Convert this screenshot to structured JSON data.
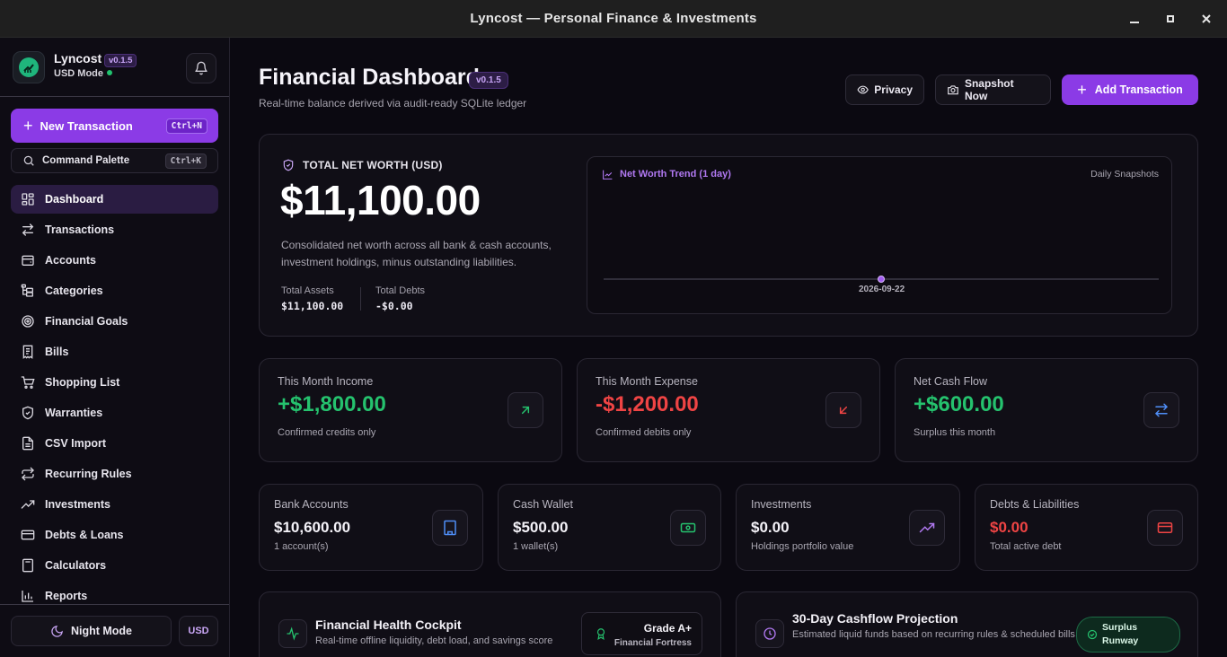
{
  "window": {
    "title": "Lyncost — Personal Finance & Investments",
    "min": "▁",
    "max": "▪",
    "close": "✕"
  },
  "brand": {
    "name": "Lyncost",
    "version": "v0.1.5",
    "mode": "USD Mode"
  },
  "sidebar": {
    "new_transaction": {
      "label": "New Transaction",
      "shortcut": "Ctrl+N"
    },
    "command_palette": {
      "label": "Command Palette",
      "shortcut": "Ctrl+K"
    },
    "items": [
      {
        "label": "Dashboard",
        "icon": "dashboard-icon",
        "active": true
      },
      {
        "label": "Transactions",
        "icon": "arrows-swap-icon"
      },
      {
        "label": "Accounts",
        "icon": "wallet-icon"
      },
      {
        "label": "Categories",
        "icon": "tree-icon"
      },
      {
        "label": "Financial Goals",
        "icon": "target-icon"
      },
      {
        "label": "Bills",
        "icon": "receipt-icon"
      },
      {
        "label": "Shopping List",
        "icon": "cart-icon"
      },
      {
        "label": "Warranties",
        "icon": "shield-check-icon"
      },
      {
        "label": "CSV Import",
        "icon": "file-icon"
      },
      {
        "label": "Recurring Rules",
        "icon": "repeat-icon"
      },
      {
        "label": "Investments",
        "icon": "trending-up-icon"
      },
      {
        "label": "Debts & Loans",
        "icon": "credit-card-icon"
      },
      {
        "label": "Calculators",
        "icon": "calculator-icon"
      },
      {
        "label": "Reports",
        "icon": "bar-chart-icon"
      }
    ],
    "night_mode": "Night Mode",
    "currency": "USD"
  },
  "header": {
    "title": "Financial Dashboard",
    "version": "v0.1.5",
    "subtitle": "Real-time balance derived via audit-ready SQLite ledger",
    "privacy": "Privacy",
    "snapshot": "Snapshot Now",
    "add_transaction": "Add Transaction"
  },
  "net_worth": {
    "label": "TOTAL NET WORTH (USD)",
    "value": "$11,100.00",
    "description": "Consolidated net worth across all bank & cash accounts, investment holdings, minus outstanding liabilities.",
    "assets_label": "Total Assets",
    "assets_value": "$11,100.00",
    "debts_label": "Total Debts",
    "debts_value": "-$0.00",
    "trend_title": "Net Worth Trend (1 day)",
    "trend_right": "Daily Snapshots"
  },
  "chart_data": {
    "type": "line",
    "title": "Net Worth Trend (1 day)",
    "x": [
      "2026-09-22"
    ],
    "series": [
      {
        "values": [
          11100
        ]
      }
    ]
  },
  "stats": [
    {
      "label": "This Month Income",
      "value": "+$1,800.00",
      "sub": "Confirmed credits only",
      "color": "#25c26e"
    },
    {
      "label": "This Month Expense",
      "value": "-$1,200.00",
      "sub": "Confirmed debits only",
      "color": "#ef4444"
    },
    {
      "label": "Net Cash Flow",
      "value": "+$600.00",
      "sub": "Surplus this month",
      "color": "#25c26e"
    }
  ],
  "accounts": [
    {
      "label": "Bank Accounts",
      "value": "$10,600.00",
      "sub": "1 account(s)"
    },
    {
      "label": "Cash Wallet",
      "value": "$500.00",
      "sub": "1 wallet(s)"
    },
    {
      "label": "Investments",
      "value": "$0.00",
      "sub": "Holdings portfolio value"
    },
    {
      "label": "Debts & Liabilities",
      "value": "$0.00",
      "sub": "Total active debt"
    }
  ],
  "health": {
    "title": "Financial Health Cockpit",
    "subtitle": "Real-time offline liquidity, debt load, and savings score",
    "grade": "Grade A+",
    "grade_sub": "Financial Fortress"
  },
  "projection": {
    "title": "30-Day Cashflow Projection",
    "subtitle": "Estimated liquid funds based on recurring rules & scheduled bills",
    "badge_line1": "Surplus",
    "badge_line2": "Runway"
  },
  "colors": {
    "accent": "#8b3be6",
    "positive": "#25c26e",
    "negative": "#ef4444"
  }
}
